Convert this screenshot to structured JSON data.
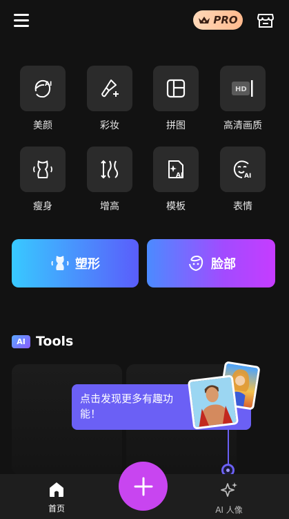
{
  "header": {
    "menu_icon": "hamburger-menu-icon",
    "pro_badge": "PRO",
    "store_icon": "store-icon"
  },
  "tools": [
    {
      "label": "美颜",
      "icon": "face-ai-icon"
    },
    {
      "label": "彩妆",
      "icon": "makeup-brush-icon"
    },
    {
      "label": "拼图",
      "icon": "collage-icon"
    },
    {
      "label": "高清画质",
      "icon": "hd-icon"
    },
    {
      "label": "瘦身",
      "icon": "slim-body-icon"
    },
    {
      "label": "增高",
      "icon": "height-icon"
    },
    {
      "label": "模板",
      "icon": "template-ai-icon"
    },
    {
      "label": "表情",
      "icon": "expression-ai-icon"
    }
  ],
  "feature_buttons": {
    "shape": "塑形",
    "face": "脸部"
  },
  "ai_section": {
    "badge": "AI",
    "title": "Tools"
  },
  "tooltip": {
    "text": "点击发现更多有趣功能！"
  },
  "bottom_nav": {
    "home": "首页",
    "ai_portrait": "AI 人像",
    "add_icon": "plus-icon"
  },
  "colors": {
    "background": "#121212",
    "tile": "#2b2b2b",
    "accent_purple": "#c845f0",
    "tooltip": "#6b60f5"
  }
}
